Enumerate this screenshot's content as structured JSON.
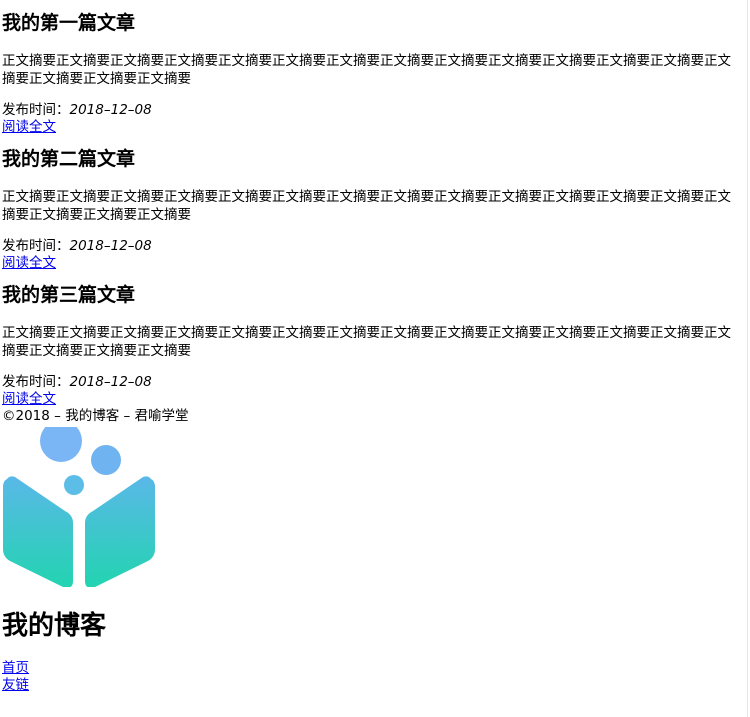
{
  "articles": [
    {
      "title": "我的第一篇文章",
      "summary": "正文摘要正文摘要正文摘要正文摘要正文摘要正文摘要正文摘要正文摘要正文摘要正文摘要正文摘要正文摘要正文摘要正文摘要正文摘要正文摘要正文摘要",
      "date_label": "发布时间：",
      "date": "2018–12–08",
      "read_more": "阅读全文"
    },
    {
      "title": "我的第二篇文章",
      "summary": "正文摘要正文摘要正文摘要正文摘要正文摘要正文摘要正文摘要正文摘要正文摘要正文摘要正文摘要正文摘要正文摘要正文摘要正文摘要正文摘要正文摘要",
      "date_label": "发布时间：",
      "date": "2018–12–08",
      "read_more": "阅读全文"
    },
    {
      "title": "我的第三篇文章",
      "summary": "正文摘要正文摘要正文摘要正文摘要正文摘要正文摘要正文摘要正文摘要正文摘要正文摘要正文摘要正文摘要正文摘要正文摘要正文摘要正文摘要正文摘要",
      "date_label": "发布时间：",
      "date": "2018–12–08",
      "read_more": "阅读全文"
    }
  ],
  "footer": {
    "copyright": "©2018 – 我的博客 – 君喻学堂"
  },
  "logo": {
    "icon": "cube-with-circles-logo",
    "colors": {
      "gradient_top": "#5ab8e8",
      "gradient_bottom": "#22d4b0",
      "circle": "#7ab6f5"
    }
  },
  "site": {
    "title": "我的博客"
  },
  "nav": {
    "items": [
      "首页",
      "友链"
    ]
  },
  "colors": {
    "link": "#0000ee",
    "text": "#000000",
    "background": "#ffffff"
  }
}
